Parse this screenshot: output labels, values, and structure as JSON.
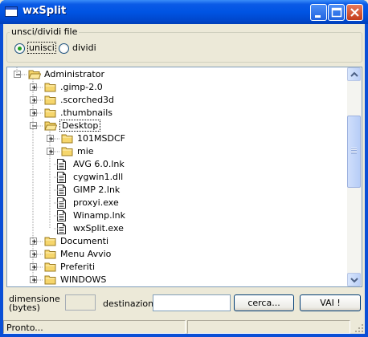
{
  "window": {
    "title": "wxSplit"
  },
  "mode": {
    "legend": "unsci/dividi file",
    "join_label": "unisci",
    "split_label": "dividi",
    "selected": "unisci"
  },
  "tree": {
    "rows": [
      {
        "label": "Administrator",
        "type": "folder-open",
        "level": 1,
        "expander": "minus"
      },
      {
        "label": ".gimp-2.0",
        "type": "folder",
        "level": 2,
        "expander": "plus"
      },
      {
        "label": ".scorched3d",
        "type": "folder",
        "level": 2,
        "expander": "plus"
      },
      {
        "label": ".thumbnails",
        "type": "folder",
        "level": 2,
        "expander": "plus"
      },
      {
        "label": "Desktop",
        "type": "folder-open",
        "level": 2,
        "expander": "minus",
        "selected": true
      },
      {
        "label": "101MSDCF",
        "type": "folder",
        "level": 3,
        "expander": "plus"
      },
      {
        "label": "mie",
        "type": "folder",
        "level": 3,
        "expander": "plus"
      },
      {
        "label": "AVG 6.0.lnk",
        "type": "file",
        "level": 3
      },
      {
        "label": "cygwin1.dll",
        "type": "file",
        "level": 3
      },
      {
        "label": "GIMP 2.lnk",
        "type": "file",
        "level": 3
      },
      {
        "label": "proxyi.exe",
        "type": "file",
        "level": 3
      },
      {
        "label": "Winamp.lnk",
        "type": "file",
        "level": 3
      },
      {
        "label": "wxSplit.exe",
        "type": "file",
        "level": 3
      },
      {
        "label": "Documenti",
        "type": "folder",
        "level": 2,
        "expander": "plus"
      },
      {
        "label": "Menu Avvio",
        "type": "folder",
        "level": 2,
        "expander": "plus"
      },
      {
        "label": "Preferiti",
        "type": "folder",
        "level": 2,
        "expander": "plus"
      },
      {
        "label": "WINDOWS",
        "type": "folder",
        "level": 2,
        "expander": "plus"
      }
    ]
  },
  "size": {
    "label_line1": "dimensione",
    "label_line2": "(bytes)",
    "value": ""
  },
  "destination": {
    "label": "destinazione",
    "value": ""
  },
  "buttons": {
    "browse": "cerca...",
    "go": "VAI !"
  },
  "status": {
    "text": "Pronto..."
  },
  "icons": [
    "app-icon",
    "minimize-icon",
    "maximize-icon",
    "close-icon",
    "folder-icon",
    "folder-open-icon",
    "file-icon",
    "scroll-up-icon",
    "scroll-down-icon",
    "resize-grip-icon"
  ]
}
